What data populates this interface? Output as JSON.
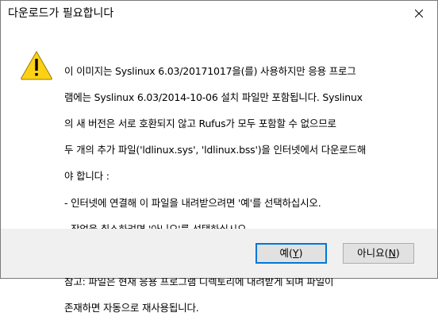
{
  "window": {
    "title": "다운로드가 필요합니다"
  },
  "icons": {
    "close": "close-icon",
    "warning": "warning-icon"
  },
  "message": {
    "lines": [
      "이 이미지는 Syslinux 6.03/20171017을(를) 사용하지만 응용 프로그",
      "램에는 Syslinux 6.03/2014-10-06 설치 파일만 포함됩니다. Syslinux",
      "의 새 버전은 서로 호환되지 않고 Rufus가 모두 포함할 수 없으므로",
      "두 개의 추가 파일('ldlinux.sys', 'ldlinux.bss')을 인터넷에서 다운로드해",
      "야 합니다 :",
      "- 인터넷에 연결해 이 파일을 내려받으려면 '예'를 선택하십시오.",
      "- 작업을 취소하려면 '아니오'를 선택하십시오.",
      "",
      "참고: 파일은 현재 응용 프로그램 디렉토리에 내려받게 되며 파일이",
      "존재하면 자동으로 재사용됩니다."
    ]
  },
  "buttons": {
    "yes": {
      "label": "예(",
      "mnemonic": "Y",
      "suffix": ")"
    },
    "no": {
      "label": "아니요(",
      "mnemonic": "N",
      "suffix": ")"
    }
  },
  "colors": {
    "accent": "#0078d7",
    "footer_bg": "#f0f0f0",
    "warning_fill": "#fcd116"
  }
}
